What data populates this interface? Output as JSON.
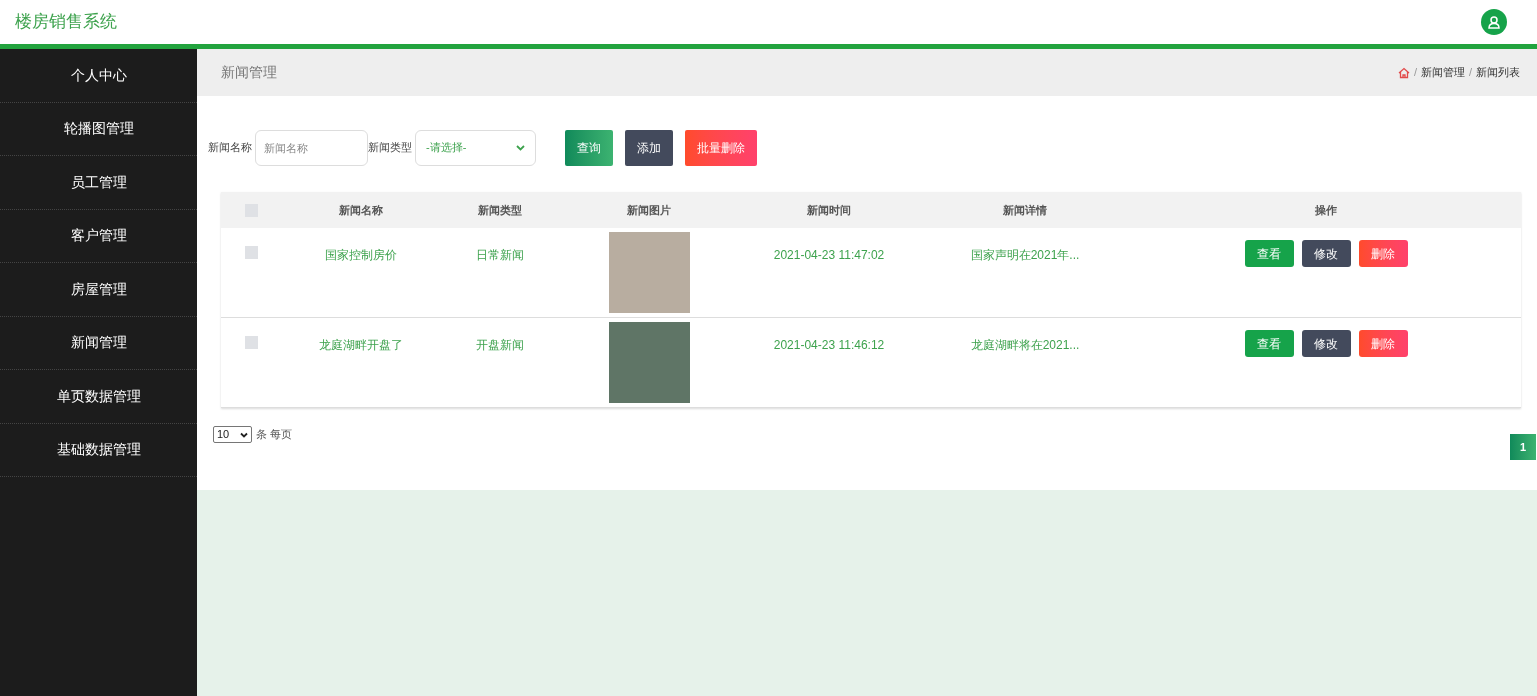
{
  "app_title": "楼房销售系统",
  "sidebar": {
    "items": [
      {
        "label": "个人中心",
        "selected": false
      },
      {
        "label": "轮播图管理",
        "selected": false
      },
      {
        "label": "员工管理",
        "selected": false
      },
      {
        "label": "客户管理",
        "selected": false
      },
      {
        "label": "房屋管理",
        "selected": false
      },
      {
        "label": "新闻管理",
        "selected": false
      },
      {
        "label": "单页数据管理",
        "selected": false
      },
      {
        "label": "基础数据管理",
        "selected": false
      }
    ]
  },
  "page_title": "新闻管理",
  "breadcrumb": {
    "separator": "/",
    "items": [
      "新闻管理",
      "新闻列表"
    ]
  },
  "filters": [
    {
      "label": "新闻名称",
      "kind": "input",
      "placeholder": "新闻名称"
    },
    {
      "label": "新闻类型",
      "kind": "select",
      "value": "-请选择-"
    }
  ],
  "actions": [
    {
      "label": "查询",
      "kind": "search"
    },
    {
      "label": "添加",
      "kind": "add"
    },
    {
      "label": "批量删除",
      "kind": "delete"
    }
  ],
  "table": {
    "select_all_checked": false,
    "columns": [
      "新闻名称",
      "新闻类型",
      "新闻图片",
      "新闻时间",
      "新闻详情",
      "操作"
    ],
    "rows": [
      {
        "checked": false,
        "name": "国家控制房价",
        "type": "日常新闻",
        "time": "2021-04-23 11:47:02",
        "detail": "国家声明在2021年...",
        "buttons": [
          {
            "label": "查看",
            "kind": "view"
          },
          {
            "label": "修改",
            "kind": "edit"
          },
          {
            "label": "删除",
            "kind": "delete"
          }
        ]
      },
      {
        "checked": false,
        "name": "龙庭湖畔开盘了",
        "type": "开盘新闻",
        "time": "2021-04-23 11:46:12",
        "detail": "龙庭湖畔将在2021...",
        "buttons": [
          {
            "label": "查看",
            "kind": "view"
          },
          {
            "label": "修改",
            "kind": "edit"
          },
          {
            "label": "删除",
            "kind": "delete"
          }
        ]
      }
    ]
  },
  "pagination": {
    "page_size": "10",
    "page_size_label": "条 每页",
    "pages": [
      {
        "label": "1",
        "selected": true
      }
    ]
  }
}
